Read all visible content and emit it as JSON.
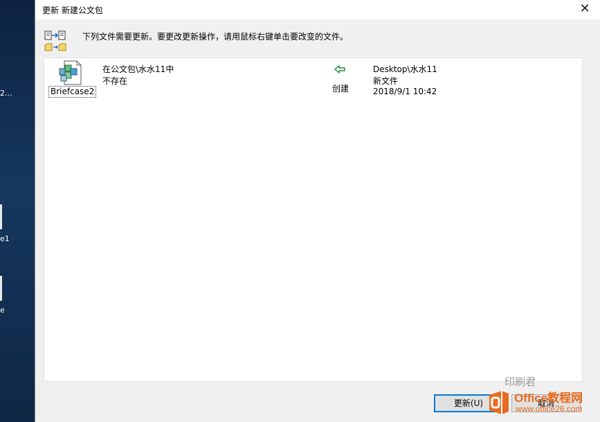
{
  "desktop": {
    "fragments": [
      "2...",
      "e1",
      "e"
    ]
  },
  "dialog": {
    "title": "更新 新建公文包",
    "close_glyph": "✕",
    "instruction": "下列文件需要更新。要更改更新操作，请用鼠标右键单击要改变的文件。",
    "item": {
      "name": "Briefcase2",
      "source_location": "在公文包\\水水11中",
      "source_status": "不存在",
      "action": "创建",
      "dest_location": "Desktop\\水水11",
      "dest_status": "新文件",
      "dest_modified": "2018/9/1 10:42"
    },
    "buttons": {
      "update_label": "更新(U)",
      "cancel_label": "取消"
    }
  },
  "watermark": {
    "brand": "Office教程网",
    "url": "www.office26.com",
    "faint": "印刷君"
  },
  "colors": {
    "accent": "#0078d7",
    "arrow_green": "#1f8a3a",
    "brand_orange": "#e96b1f"
  }
}
